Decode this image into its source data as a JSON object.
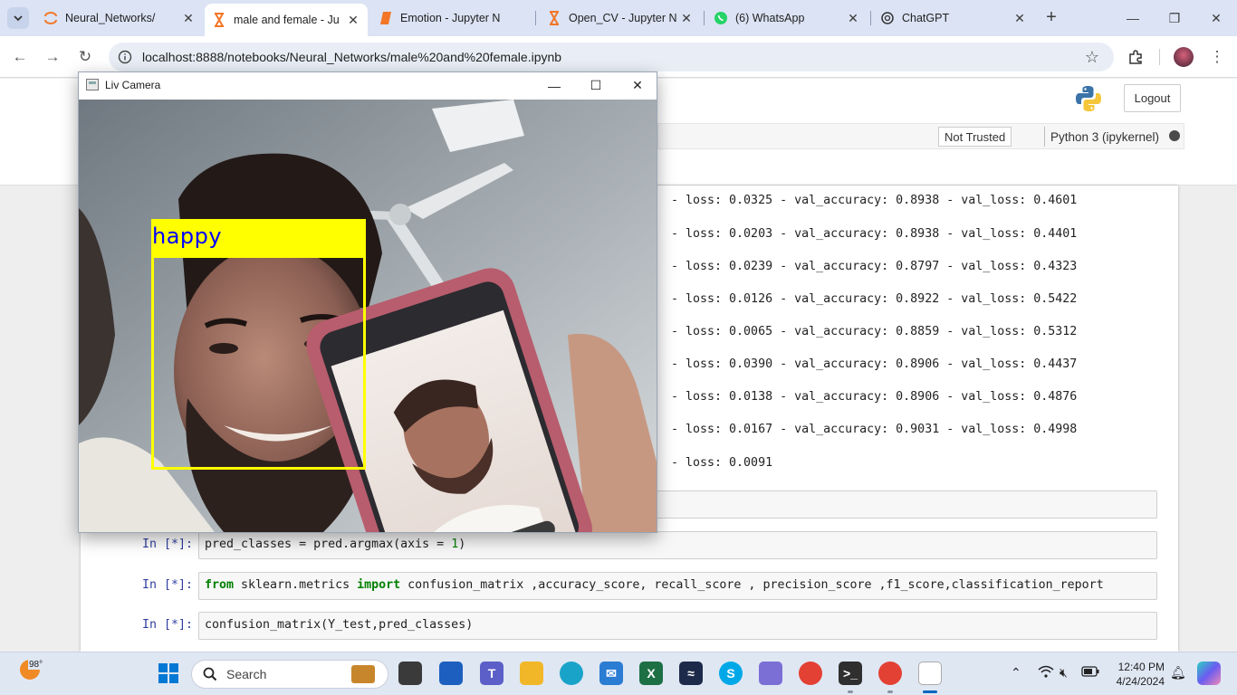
{
  "browser": {
    "tabs": [
      {
        "title": "Neural_Networks/",
        "active": false
      },
      {
        "title": "male and female - Ju",
        "active": true
      },
      {
        "title": "Emotion - Jupyter N",
        "active": false
      },
      {
        "title": "Open_CV - Jupyter N",
        "active": false
      },
      {
        "title": "(6) WhatsApp",
        "active": false
      },
      {
        "title": "ChatGPT",
        "active": false
      }
    ],
    "url": "localhost:8888/notebooks/Neural_Networks/male%20and%20female.ipynb"
  },
  "jupyter": {
    "logout_label": "Logout",
    "trust_label": "Not Trusted",
    "kernel_label": "Python 3 (ipykernel)",
    "output_lines": [
      "- loss: 0.0325 - val_accuracy: 0.8938 - val_loss: 0.4601",
      "- loss: 0.0203 - val_accuracy: 0.8938 - val_loss: 0.4401",
      "- loss: 0.0239 - val_accuracy: 0.8797 - val_loss: 0.4323",
      "- loss: 0.0126 - val_accuracy: 0.8922 - val_loss: 0.5422",
      "- loss: 0.0065 - val_accuracy: 0.8859 - val_loss: 0.5312",
      "- loss: 0.0390 - val_accuracy: 0.8906 - val_loss: 0.4437",
      "- loss: 0.0138 - val_accuracy: 0.8906 - val_loss: 0.4876",
      "- loss: 0.0167 - val_accuracy: 0.9031 - val_loss: 0.4998",
      "- loss: 0.0091"
    ],
    "cells": [
      {
        "prompt": "In [*]:",
        "code_parts": [
          "pred_classes = pred.argmax(axis = ",
          "1",
          ")"
        ]
      },
      {
        "prompt": "In [*]:",
        "code_parts": [
          "from",
          " sklearn.metrics ",
          "import",
          " confusion_matrix ,accuracy_score, recall_score , precision_score ,f1_score,classification_report"
        ]
      },
      {
        "prompt": "In [*]:",
        "code_parts": [
          "confusion_matrix(Y_test,pred_classes)"
        ]
      }
    ]
  },
  "camera_window": {
    "title": "Liv Camera",
    "prediction_label": "happy",
    "box_color": "#ffff00",
    "label_text_color": "#0000ff"
  },
  "taskbar": {
    "temperature": "98°",
    "search_placeholder": "Search",
    "time": "12:40 PM",
    "date": "4/24/2024"
  }
}
